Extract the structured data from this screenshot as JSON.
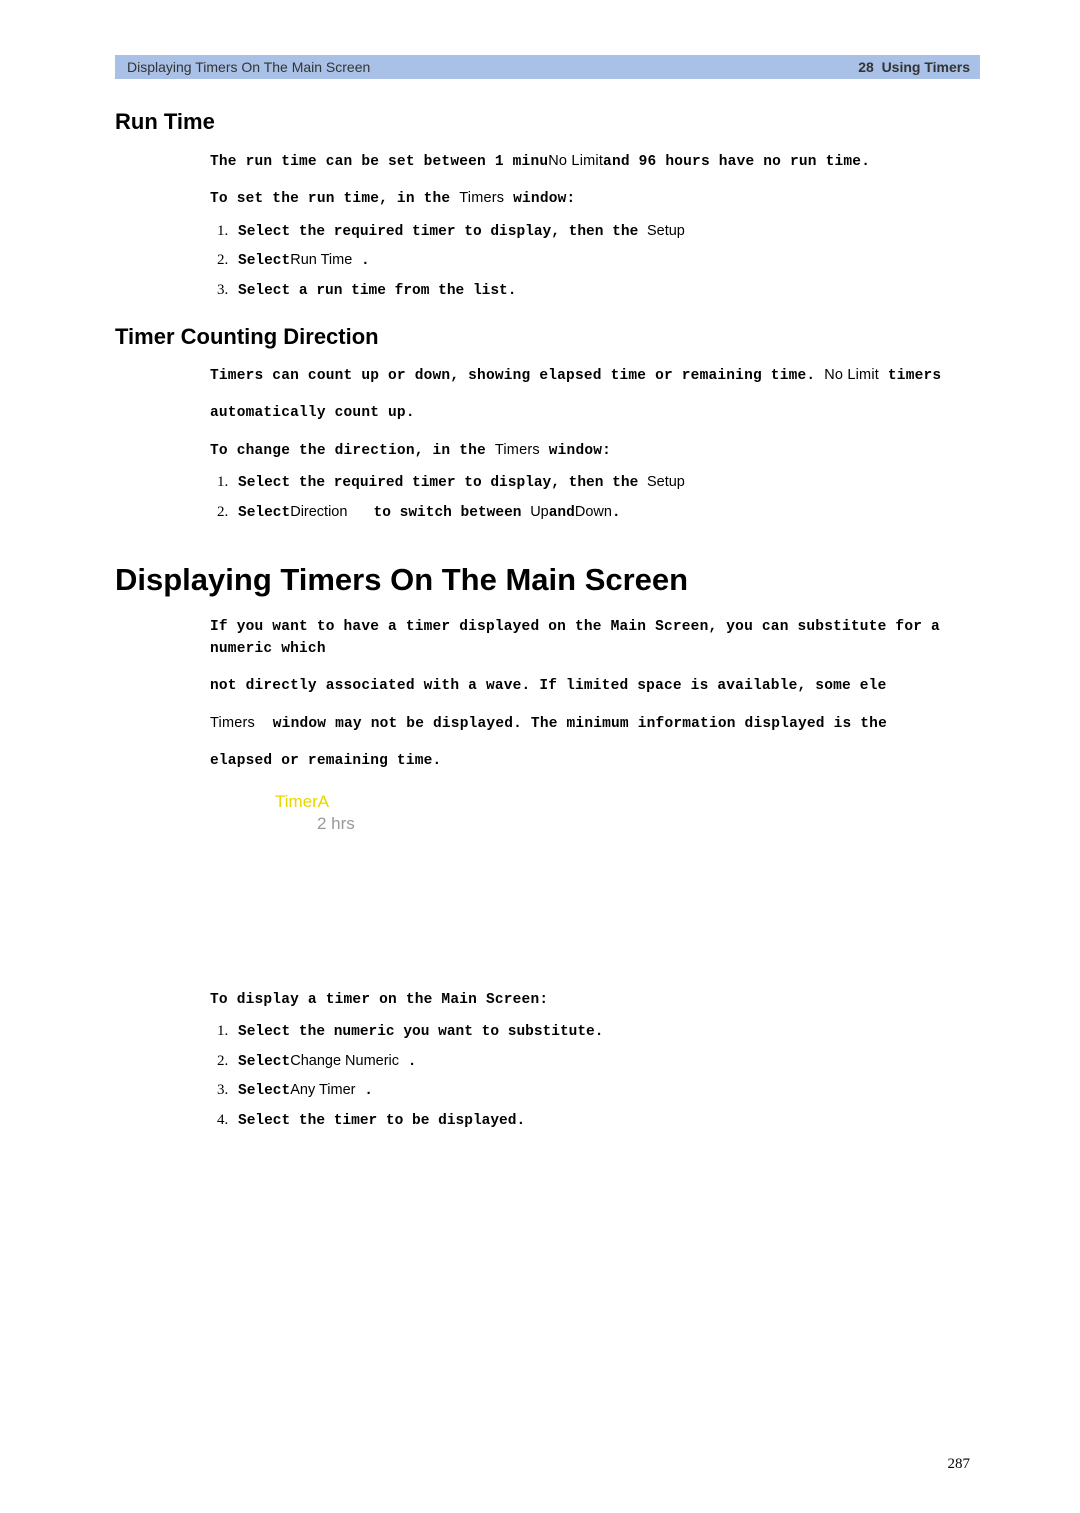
{
  "header": {
    "left": "Displaying Timers On The Main Screen",
    "right_num": "28",
    "right_text": "Using Timers"
  },
  "runTime": {
    "heading": "Run Time",
    "p1_a": "The run time can be set between 1 minu",
    "p1_b": "No Limit",
    "p1_c": "and 96 hours have no run time.",
    "p2_a": "To set the run time, in the",
    "p2_b": "Timers",
    "p2_c": "window:",
    "steps": {
      "s1_a": "Select the required timer to display, then the",
      "s1_b": "Setup",
      "s2_a": "Select",
      "s2_b": "Run Time",
      "s2_c": ".",
      "s3": "Select a run time from the list."
    }
  },
  "direction": {
    "heading": "Timer Counting Direction",
    "p1_a": "Timers can count up or down, showing elapsed time or remaining time.",
    "p1_b": "No Limit",
    "p1_c": "timers",
    "p2": "automatically count up.",
    "p3_a": "To change the direction, in the",
    "p3_b": "Timers",
    "p3_c": "window:",
    "steps": {
      "s1_a": "Select the required timer to display, then the",
      "s1_b": "Setup",
      "s2_a": "Select",
      "s2_b": "Direction",
      "s2_c": "to switch between",
      "s2_d": "Up",
      "s2_e": "and",
      "s2_f": "Down",
      "s2_g": "."
    }
  },
  "display": {
    "heading": "Displaying Timers On The Main Screen",
    "p1_a": "If you want to have a timer displayed on the Main Screen, you can substitute",
    "p1_b": "for a numeric which",
    "p2": "not directly associated with a wave. If limited space is available, some ele",
    "p3_a": "Timers",
    "p3_b": "window may not be displayed. The minimum information displayed is the",
    "p4": "elapsed or remaining time.",
    "timer_label": "TimerA",
    "timer_value": "2 hrs",
    "p5": "To display a timer on the Main Screen:",
    "steps": {
      "s1": "Select the numeric you want to substitute.",
      "s2_a": "Select",
      "s2_b": "Change Numeric",
      "s2_c": ".",
      "s3_a": "Select",
      "s3_b": "Any Timer",
      "s3_c": ".",
      "s4": "Select the timer to be displayed."
    }
  },
  "pageNumber": "287"
}
